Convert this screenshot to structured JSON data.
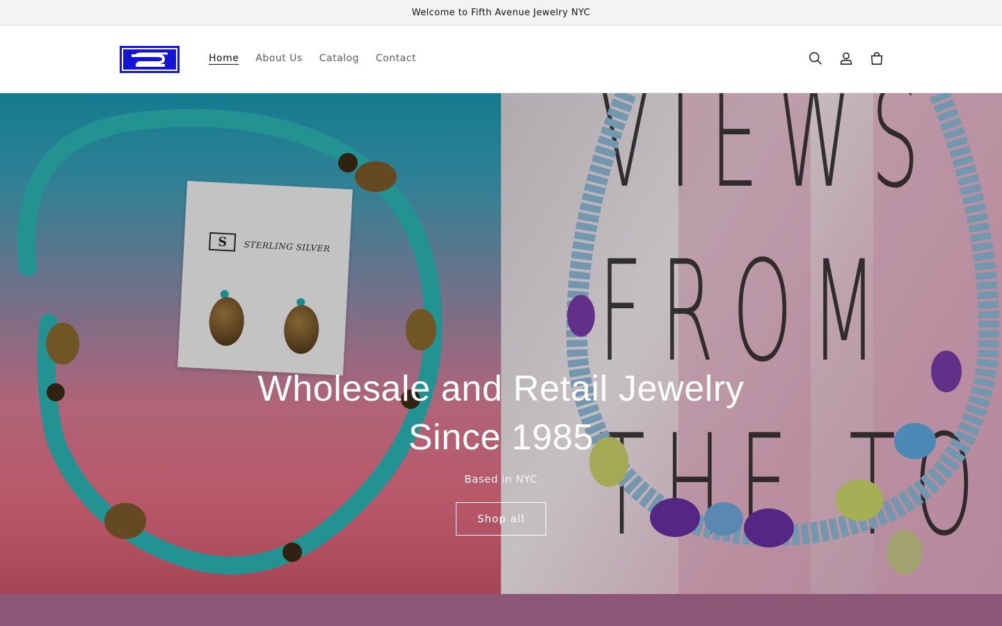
{
  "announcement": {
    "text": "Welcome to Fifth Avenue Jewelry NYC"
  },
  "header": {
    "logo_icon": "fifth-avenue-jewelry-logo",
    "nav": [
      {
        "label": "Home",
        "active": true
      },
      {
        "label": "About Us",
        "active": false
      },
      {
        "label": "Catalog",
        "active": false
      },
      {
        "label": "Contact",
        "active": false
      }
    ],
    "icons": [
      "search-icon",
      "account-icon",
      "cart-icon"
    ]
  },
  "hero": {
    "title": "Wholesale and Retail Jewelry Since 1985",
    "subtitle": "Based in NYC",
    "button_label": "Shop all",
    "card_text": "STERLING SILVER",
    "card_logo_letter": "S",
    "background_lettering": "VIEWS\nFROM\nTHE TOP"
  },
  "colors": {
    "accent_blue": "#1414d8",
    "bottom_band": "#8c5676",
    "announcement_bg": "#f3f3f3"
  }
}
